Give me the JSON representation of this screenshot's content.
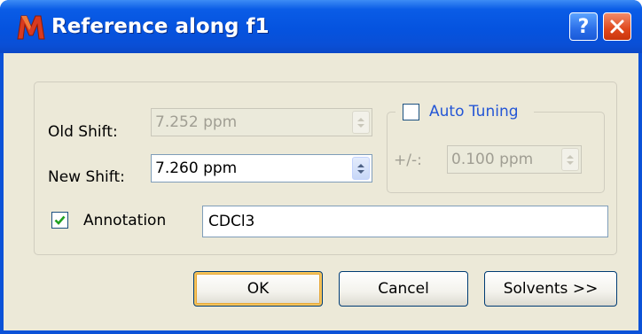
{
  "window": {
    "title": "Reference along f1",
    "help_glyph": "?",
    "app_icon": "mnova-logo-icon",
    "colors": {
      "titlebar": "#0553df",
      "client": "#ece9d8",
      "link_blue": "#2456d6",
      "disabled_text": "#a09e93"
    }
  },
  "form": {
    "old_shift": {
      "label": "Old Shift:",
      "value": "7.252 ppm",
      "enabled": false
    },
    "new_shift": {
      "label": "New Shift:",
      "value": "7.260 ppm",
      "enabled": true
    },
    "auto_tuning": {
      "label": "Auto Tuning",
      "checked": false,
      "tolerance_label": "+/-:",
      "tolerance_value": "0.100 ppm",
      "tolerance_enabled": false
    },
    "annotation": {
      "label": "Annotation",
      "checked": true,
      "value": "CDCl3"
    }
  },
  "buttons": {
    "ok": "OK",
    "cancel": "Cancel",
    "solvents": "Solvents >>"
  }
}
